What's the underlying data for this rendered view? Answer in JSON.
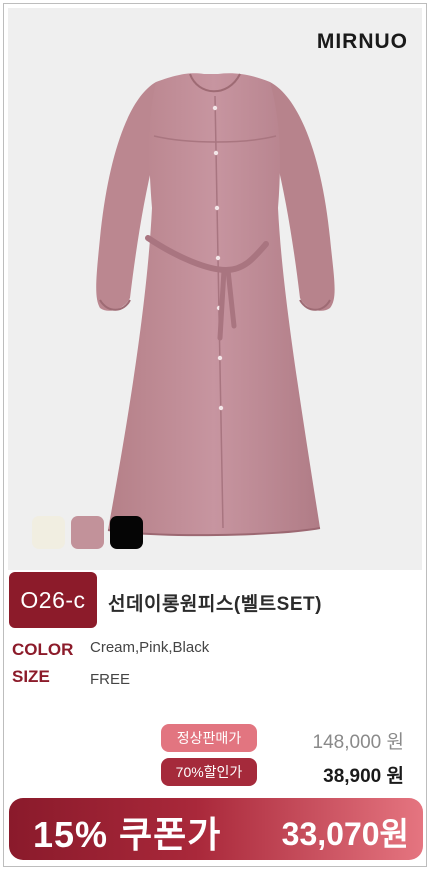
{
  "brand": "MIRNUO",
  "swatches": [
    {
      "name": "Cream",
      "color": "#f1eee1"
    },
    {
      "name": "Pink",
      "color": "#c2929a"
    },
    {
      "name": "Black",
      "color": "#050505"
    }
  ],
  "product": {
    "code": "O26-c",
    "title": "선데이롱원피스(벨트SET)",
    "color_label": "COLOR",
    "color_value": "Cream,Pink,Black",
    "size_label": "SIZE",
    "size_value": "FREE"
  },
  "pricing": {
    "regular_label": "정상판매가",
    "regular_price": "148,000 원",
    "discount_label": "70%할인가",
    "discount_price": "38,900 원",
    "coupon_label": "15% 쿠폰가",
    "coupon_price": "33,070원"
  },
  "colors": {
    "accent": "#8c1b2a",
    "regular_pill": "#e27580",
    "discount_pill": "#a52a3b",
    "dress": "#c2929a"
  }
}
